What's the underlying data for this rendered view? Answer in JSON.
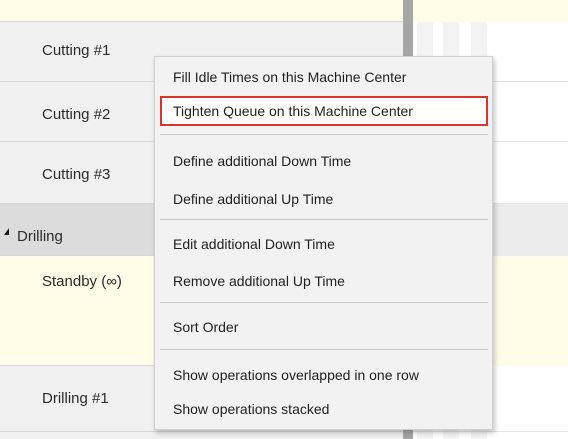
{
  "resources": [
    {
      "label": "Cutting #1",
      "kind": "item"
    },
    {
      "label": "Cutting #2",
      "kind": "item"
    },
    {
      "label": "Cutting #3",
      "kind": "item"
    },
    {
      "label": "Drilling",
      "kind": "group"
    },
    {
      "label": "Standby (∞)",
      "kind": "standby"
    },
    {
      "label": "Drilling #1",
      "kind": "item"
    }
  ],
  "context_menu": {
    "items": [
      {
        "label": "Fill Idle Times on this Machine Center",
        "highlighted": false
      },
      {
        "label": "Tighten Queue on this Machine Center",
        "highlighted": true
      },
      {
        "label": "Define additional Down Time",
        "highlighted": false
      },
      {
        "label": "Define additional Up Time",
        "highlighted": false
      },
      {
        "label": "Edit additional Down Time",
        "highlighted": false
      },
      {
        "label": "Remove additional Up Time",
        "highlighted": false
      },
      {
        "label": "Sort Order",
        "highlighted": false
      },
      {
        "label": "Show operations overlapped in one row",
        "highlighted": false
      },
      {
        "label": "Show operations stacked",
        "highlighted": false
      }
    ],
    "highlight_color": "#d9342b"
  },
  "colors": {
    "panel_bg": "#f0f0f0",
    "group_bg": "#dcdcdc",
    "standby_bg": "#fffde8",
    "splitter": "#a6a6a6"
  }
}
